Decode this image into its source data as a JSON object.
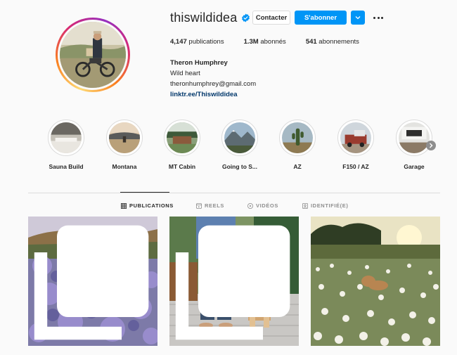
{
  "profile": {
    "username": "thiswildidea",
    "verified": true,
    "contact_label": "Contacter",
    "follow_label": "S'abonner",
    "stats": {
      "posts_value": "4,147",
      "posts_label": " publications",
      "followers_value": "1.3M",
      "followers_label": " abonnés",
      "following_value": "541",
      "following_label": " abonnements"
    },
    "bio": {
      "name": "Theron Humphrey",
      "line1": "Wild heart",
      "email": "theronhumphrey@gmail.com",
      "link": "linktr.ee/Thiswildidea"
    }
  },
  "highlights": [
    {
      "label": "Sauna Build"
    },
    {
      "label": "Montana"
    },
    {
      "label": "MT Cabin"
    },
    {
      "label": "Going to S..."
    },
    {
      "label": "AZ"
    },
    {
      "label": "F150 / AZ"
    },
    {
      "label": "Garage"
    }
  ],
  "tabs": [
    {
      "label": "PUBLICATIONS",
      "icon": "grid-icon",
      "active": true
    },
    {
      "label": "REELS",
      "icon": "reels-icon",
      "active": false
    },
    {
      "label": "VIDÉOS",
      "icon": "play-icon",
      "active": false
    },
    {
      "label": "IDENTIFIÉ(E)",
      "icon": "tag-icon",
      "active": false
    }
  ],
  "posts": [
    {
      "description": "dog in lavender field",
      "multi": true
    },
    {
      "description": "man and dog on dock",
      "multi": true
    },
    {
      "description": "dog in daisy field",
      "multi": false
    }
  ],
  "colors": {
    "accent": "#0095f6",
    "link": "#00376b",
    "text": "#262626",
    "muted": "#8e8e8e",
    "border": "#dbdbdb",
    "background": "#fafafa"
  }
}
